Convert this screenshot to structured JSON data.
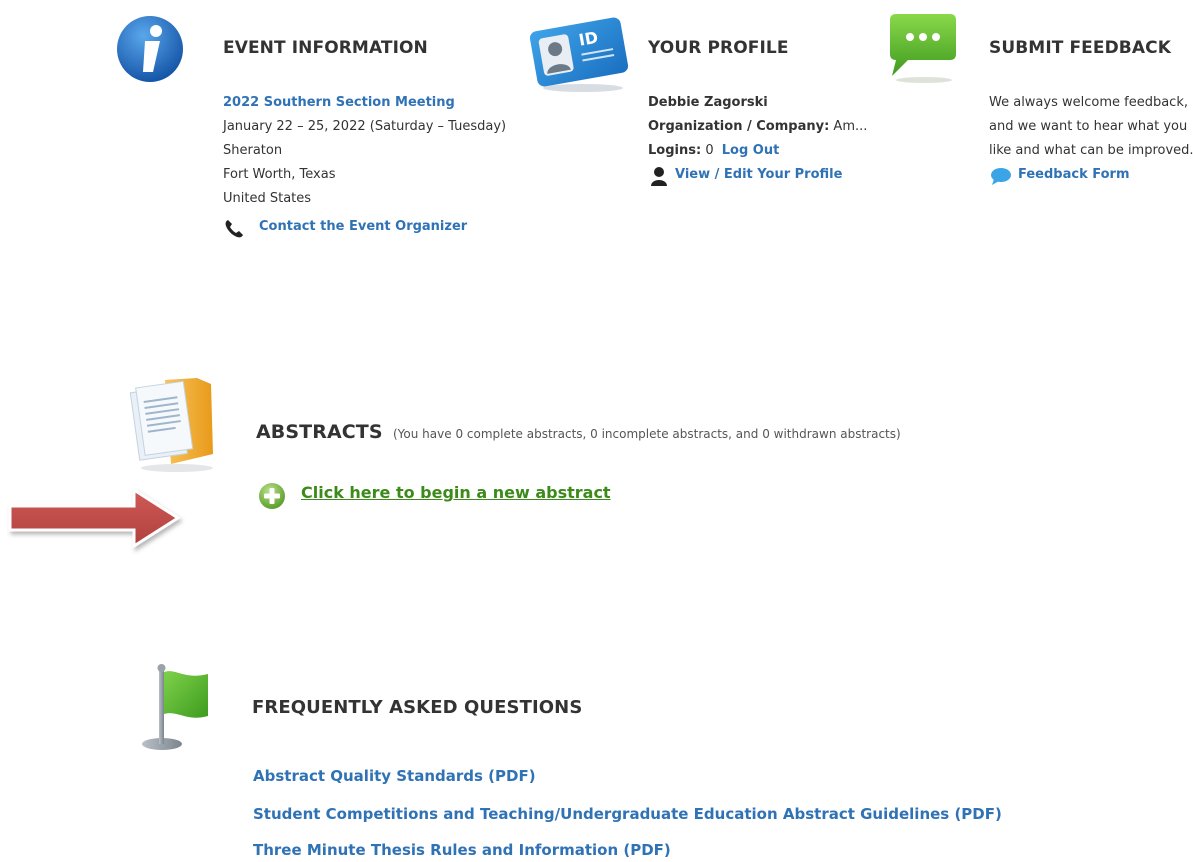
{
  "event": {
    "title": "EVENT INFORMATION",
    "meeting_link": "2022 Southern Section Meeting",
    "dates": "January 22 – 25, 2022 (Saturday – Tuesday)",
    "venue": "Sheraton",
    "city": "Fort Worth, Texas",
    "country": "United States",
    "contact_link": "Contact the Event Organizer"
  },
  "profile": {
    "title": "YOUR PROFILE",
    "name": "Debbie Zagorski",
    "org_label": "Organization / Company:",
    "org_value": "Am...",
    "logins_label": "Logins:",
    "logins_value": "0",
    "logout_link": "Log Out",
    "edit_link": "View / Edit Your Profile",
    "id_badge": "ID"
  },
  "feedback": {
    "title": "SUBMIT FEEDBACK",
    "line1": "We always welcome feedback,",
    "line2": "and we want to hear what you",
    "line3": "like and what can be improved.",
    "form_link": "Feedback Form"
  },
  "abstracts": {
    "title": "ABSTRACTS",
    "summary": "(You have 0 complete abstracts, 0 incomplete abstracts, and 0 withdrawn abstracts)",
    "new_link": "Click here to begin a new abstract"
  },
  "faq": {
    "title": "FREQUENTLY ASKED QUESTIONS",
    "links": [
      "Abstract Quality Standards (PDF)",
      "Student Competitions and Teaching/Undergraduate Education Abstract Guidelines (PDF)",
      "Three Minute Thesis Rules and Information (PDF)"
    ]
  },
  "colors": {
    "link": "#2f72b5",
    "green_link": "#3c8a1a",
    "arrow": "#c0504d",
    "info_blue": "#1f6fc4",
    "feedback_green": "#5bb52e"
  },
  "icons": [
    "info-icon",
    "id-card-icon",
    "chat-bubble-icon",
    "phone-icon",
    "person-icon",
    "speech-bubble-icon",
    "folder-icon",
    "plus-circle-icon",
    "flag-icon",
    "arrow-icon"
  ]
}
